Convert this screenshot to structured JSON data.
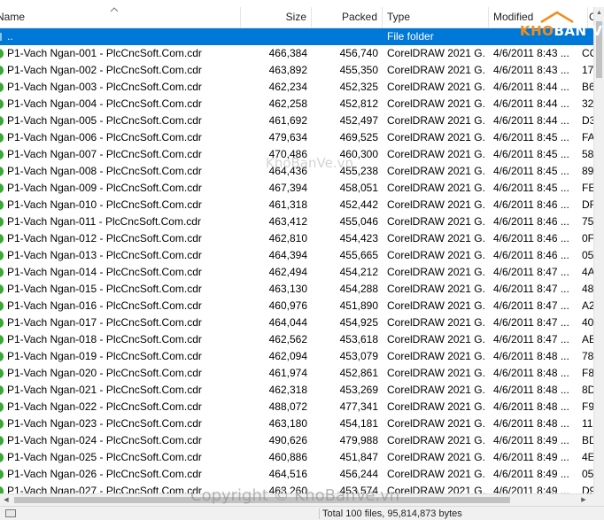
{
  "columns": {
    "name": "Name",
    "size": "Size",
    "packed": "Packed",
    "type": "Type",
    "modified": "Modified",
    "crc": "C"
  },
  "parent_row": {
    "name": "..",
    "type": "File folder"
  },
  "rows": [
    {
      "name": "P1-Vach Ngan-001 - PlcCncSoft.Com.cdr",
      "size": "466,384",
      "packed": "456,740",
      "type": "CorelDRAW 2021 G...",
      "modified": "4/6/2011 8:43 ...",
      "crc": "CC"
    },
    {
      "name": "P1-Vach Ngan-002 - PlcCncSoft.Com.cdr",
      "size": "463,892",
      "packed": "455,350",
      "type": "CorelDRAW 2021 G...",
      "modified": "4/6/2011 8:43 ...",
      "crc": "17"
    },
    {
      "name": "P1-Vach Ngan-003 - PlcCncSoft.Com.cdr",
      "size": "462,234",
      "packed": "452,325",
      "type": "CorelDRAW 2021 G...",
      "modified": "4/6/2011 8:44 ...",
      "crc": "B6"
    },
    {
      "name": "P1-Vach Ngan-004 - PlcCncSoft.Com.cdr",
      "size": "462,258",
      "packed": "452,812",
      "type": "CorelDRAW 2021 G...",
      "modified": "4/6/2011 8:44 ...",
      "crc": "32"
    },
    {
      "name": "P1-Vach Ngan-005 - PlcCncSoft.Com.cdr",
      "size": "461,692",
      "packed": "452,497",
      "type": "CorelDRAW 2021 G...",
      "modified": "4/6/2011 8:44 ...",
      "crc": "D3"
    },
    {
      "name": "P1-Vach Ngan-006 - PlcCncSoft.Com.cdr",
      "size": "479,634",
      "packed": "469,525",
      "type": "CorelDRAW 2021 G...",
      "modified": "4/6/2011 8:45 ...",
      "crc": "FA"
    },
    {
      "name": "P1-Vach Ngan-007 - PlcCncSoft.Com.cdr",
      "size": "470,486",
      "packed": "460,300",
      "type": "CorelDRAW 2021 G...",
      "modified": "4/6/2011 8:45 ...",
      "crc": "58"
    },
    {
      "name": "P1-Vach Ngan-008 - PlcCncSoft.Com.cdr",
      "size": "464,436",
      "packed": "455,238",
      "type": "CorelDRAW 2021 G...",
      "modified": "4/6/2011 8:45 ...",
      "crc": "89"
    },
    {
      "name": "P1-Vach Ngan-009 - PlcCncSoft.Com.cdr",
      "size": "467,394",
      "packed": "458,051",
      "type": "CorelDRAW 2021 G...",
      "modified": "4/6/2011 8:45 ...",
      "crc": "FE"
    },
    {
      "name": "P1-Vach Ngan-010 - PlcCncSoft.Com.cdr",
      "size": "461,318",
      "packed": "452,442",
      "type": "CorelDRAW 2021 G...",
      "modified": "4/6/2011 8:46 ...",
      "crc": "DF"
    },
    {
      "name": "P1-Vach Ngan-011 - PlcCncSoft.Com.cdr",
      "size": "463,412",
      "packed": "455,046",
      "type": "CorelDRAW 2021 G...",
      "modified": "4/6/2011 8:46 ...",
      "crc": "75"
    },
    {
      "name": "P1-Vach Ngan-012 - PlcCncSoft.Com.cdr",
      "size": "462,810",
      "packed": "454,423",
      "type": "CorelDRAW 2021 G...",
      "modified": "4/6/2011 8:46 ...",
      "crc": "0F"
    },
    {
      "name": "P1-Vach Ngan-013 - PlcCncSoft.Com.cdr",
      "size": "464,394",
      "packed": "455,665",
      "type": "CorelDRAW 2021 G...",
      "modified": "4/6/2011 8:46 ...",
      "crc": "05"
    },
    {
      "name": "P1-Vach Ngan-014 - PlcCncSoft.Com.cdr",
      "size": "462,494",
      "packed": "454,212",
      "type": "CorelDRAW 2021 G...",
      "modified": "4/6/2011 8:47 ...",
      "crc": "4A"
    },
    {
      "name": "P1-Vach Ngan-015 - PlcCncSoft.Com.cdr",
      "size": "463,130",
      "packed": "454,288",
      "type": "CorelDRAW 2021 G...",
      "modified": "4/6/2011 8:47 ...",
      "crc": "48"
    },
    {
      "name": "P1-Vach Ngan-016 - PlcCncSoft.Com.cdr",
      "size": "460,976",
      "packed": "451,890",
      "type": "CorelDRAW 2021 G...",
      "modified": "4/6/2011 8:47 ...",
      "crc": "A2"
    },
    {
      "name": "P1-Vach Ngan-017 - PlcCncSoft.Com.cdr",
      "size": "464,044",
      "packed": "454,925",
      "type": "CorelDRAW 2021 G...",
      "modified": "4/6/2011 8:47 ...",
      "crc": "40"
    },
    {
      "name": "P1-Vach Ngan-018 - PlcCncSoft.Com.cdr",
      "size": "462,562",
      "packed": "453,618",
      "type": "CorelDRAW 2021 G...",
      "modified": "4/6/2011 8:47 ...",
      "crc": "AE"
    },
    {
      "name": "P1-Vach Ngan-019 - PlcCncSoft.Com.cdr",
      "size": "462,094",
      "packed": "453,079",
      "type": "CorelDRAW 2021 G...",
      "modified": "4/6/2011 8:48 ...",
      "crc": "78"
    },
    {
      "name": "P1-Vach Ngan-020 - PlcCncSoft.Com.cdr",
      "size": "461,974",
      "packed": "452,861",
      "type": "CorelDRAW 2021 G...",
      "modified": "4/6/2011 8:48 ...",
      "crc": "F8"
    },
    {
      "name": "P1-Vach Ngan-021 - PlcCncSoft.Com.cdr",
      "size": "462,318",
      "packed": "453,269",
      "type": "CorelDRAW 2021 G...",
      "modified": "4/6/2011 8:48 ...",
      "crc": "8D"
    },
    {
      "name": "P1-Vach Ngan-022 - PlcCncSoft.Com.cdr",
      "size": "488,072",
      "packed": "477,341",
      "type": "CorelDRAW 2021 G...",
      "modified": "4/6/2011 8:48 ...",
      "crc": "F9"
    },
    {
      "name": "P1-Vach Ngan-023 - PlcCncSoft.Com.cdr",
      "size": "463,180",
      "packed": "454,181",
      "type": "CorelDRAW 2021 G...",
      "modified": "4/6/2011 8:48 ...",
      "crc": "11"
    },
    {
      "name": "P1-Vach Ngan-024 - PlcCncSoft.Com.cdr",
      "size": "490,626",
      "packed": "479,988",
      "type": "CorelDRAW 2021 G...",
      "modified": "4/6/2011 8:49 ...",
      "crc": "BD"
    },
    {
      "name": "P1-Vach Ngan-025 - PlcCncSoft.Com.cdr",
      "size": "460,886",
      "packed": "451,847",
      "type": "CorelDRAW 2021 G...",
      "modified": "4/6/2011 8:49 ...",
      "crc": "4E"
    },
    {
      "name": "P1-Vach Ngan-026 - PlcCncSoft.Com.cdr",
      "size": "464,516",
      "packed": "456,244",
      "type": "CorelDRAW 2021 G...",
      "modified": "4/6/2011 8:49 ...",
      "crc": "05"
    },
    {
      "name": "P1-Vach Ngan-027 - PlcCncSoft.Com.cdr",
      "size": "463,260",
      "packed": "453,574",
      "type": "CorelDRAW 2021 G...",
      "modified": "4/6/2011 8:49 ...",
      "crc": "D9"
    }
  ],
  "status": {
    "text": "Total 100 files, 95,814,873 bytes"
  },
  "watermarks": {
    "logo_orange": "KHO",
    "logo_white": "BẢN VẼ",
    "center": "KhoBanVe.vn",
    "bottom": "Copyright © KhoBanVe.vn"
  },
  "colors": {
    "selection": "#0078d7",
    "file_icon": "#3aa835",
    "logo_orange": "#f28c1a"
  },
  "icons": {
    "file": "coreldraw-file-icon",
    "parent": "folder-up-icon",
    "sort": "sort-ascending-icon"
  }
}
